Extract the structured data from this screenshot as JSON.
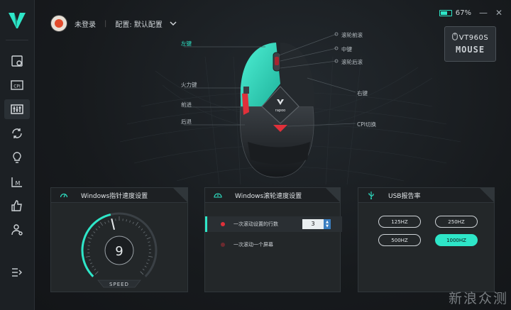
{
  "user": {
    "login_status": "未登录",
    "config_label": "配置: 默认配置"
  },
  "battery": {
    "percent_text": "67%",
    "level": 0.67
  },
  "window": {
    "minimize": "—",
    "close": "✕"
  },
  "device": {
    "model": "VT960S",
    "type": "MOUSE"
  },
  "sidebar": {
    "items": [
      {
        "icon": "dashboard-icon"
      },
      {
        "icon": "cpi-icon",
        "text": "CPI"
      },
      {
        "icon": "equalizer-icon",
        "active": true
      },
      {
        "icon": "sync-icon"
      },
      {
        "icon": "lightbulb-icon"
      },
      {
        "icon": "macro-icon",
        "text": "M"
      },
      {
        "icon": "thumbs-up-icon"
      },
      {
        "icon": "user-settings-icon"
      },
      {
        "icon": "menu-expand-icon"
      }
    ]
  },
  "mouse_labels": {
    "left_key": "左键",
    "fire_key": "火力键",
    "forward": "前进",
    "back": "后退",
    "scroll_forward": "滚轮前滚",
    "middle_key": "中键",
    "scroll_back": "滚轮后滚",
    "right_key": "右键",
    "cpi_switch": "CPI切换"
  },
  "mouse_brand": "rapoo",
  "pointer_panel": {
    "title": "Windows指针速度设置",
    "speed_value": "9",
    "speed_label": "SPEED",
    "speed_level": 9,
    "speed_max": 20
  },
  "scroll_panel": {
    "title": "Windows滚轮速度设置",
    "options": [
      {
        "label": "一次滚动设置的行数",
        "value": "3",
        "selected": true
      },
      {
        "label": "一次滚动一个屏幕",
        "selected": false
      }
    ]
  },
  "usb_panel": {
    "title": "USB报告率",
    "rates": [
      "125HZ",
      "250HZ",
      "500HZ",
      "1000HZ"
    ],
    "selected": "1000HZ"
  },
  "watermark": "新浪众测",
  "colors": {
    "accent": "#2ee6c8",
    "fire_red": "#e0303a"
  }
}
